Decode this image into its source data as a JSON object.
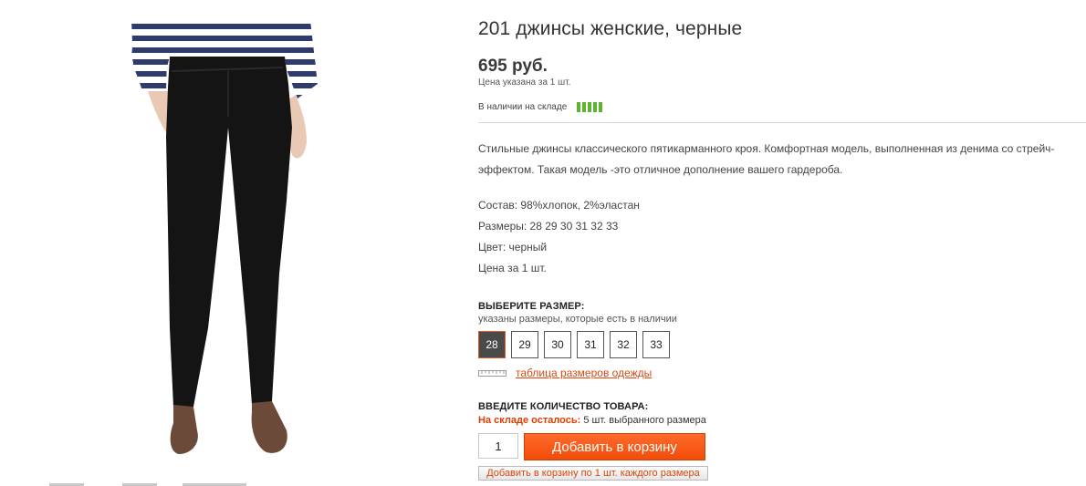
{
  "product": {
    "title": "201 джинсы женские, черные",
    "price": "695 руб.",
    "price_note": "Цена указана за 1 шт.",
    "stock_label": "В наличии на складе",
    "stock_level": 5,
    "stock_color": "#5bb52f",
    "description": "Стильные джинсы классического пятикарманного кроя. Комфортная модель, выполненная из денима со стрейч-эффектом. Такая модель -это отличное дополнение вашего гардероба.",
    "specs": [
      "Состав: 98%хлопок, 2%эластан",
      "Размеры: 28 29 30 31 32 33",
      "Цвет: черный",
      "Цена за 1 шт."
    ]
  },
  "size_select": {
    "title": "ВЫБЕРИТЕ РАЗМЕР:",
    "hint": "указаны размеры, которые есть в наличии",
    "sizes": [
      "28",
      "29",
      "30",
      "31",
      "32",
      "33"
    ],
    "selected": "28",
    "size_table_link": "таблица размеров одежды",
    "ruler_icon": "ruler-icon"
  },
  "quantity": {
    "title": "ВВЕДИТЕ КОЛИЧЕСТВО ТОВАРА:",
    "left_label": "На складе осталось:",
    "left_text": "5 шт. выбранного размера",
    "value": "1",
    "add_to_cart": "Добавить в корзину",
    "add_each": "Добавить в корзину по 1 шт. каждого размера"
  },
  "colors": {
    "accent": "#f24c0a",
    "link": "#d9480f",
    "warning": "#e03c00"
  }
}
